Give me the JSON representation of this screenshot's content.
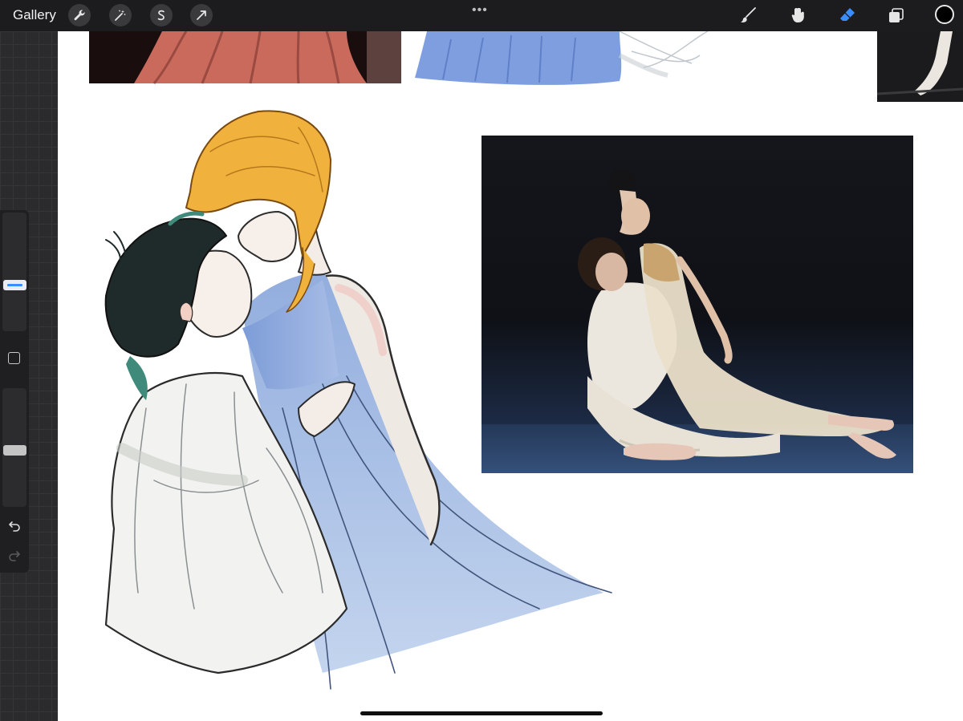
{
  "toolbar": {
    "gallery_label": "Gallery",
    "left_tools": [
      "wrench-icon",
      "magic-wand-icon",
      "selection-icon",
      "transform-arrow-icon"
    ],
    "right_tools": [
      "brush-icon",
      "smudge-icon",
      "eraser-icon",
      "layers-icon"
    ],
    "active_tool": "eraser-icon",
    "active_color": "#000000",
    "accent": "#3a8dff"
  },
  "sidebar": {
    "brush_size_level": 0.55,
    "opacity_level": 0.5
  }
}
